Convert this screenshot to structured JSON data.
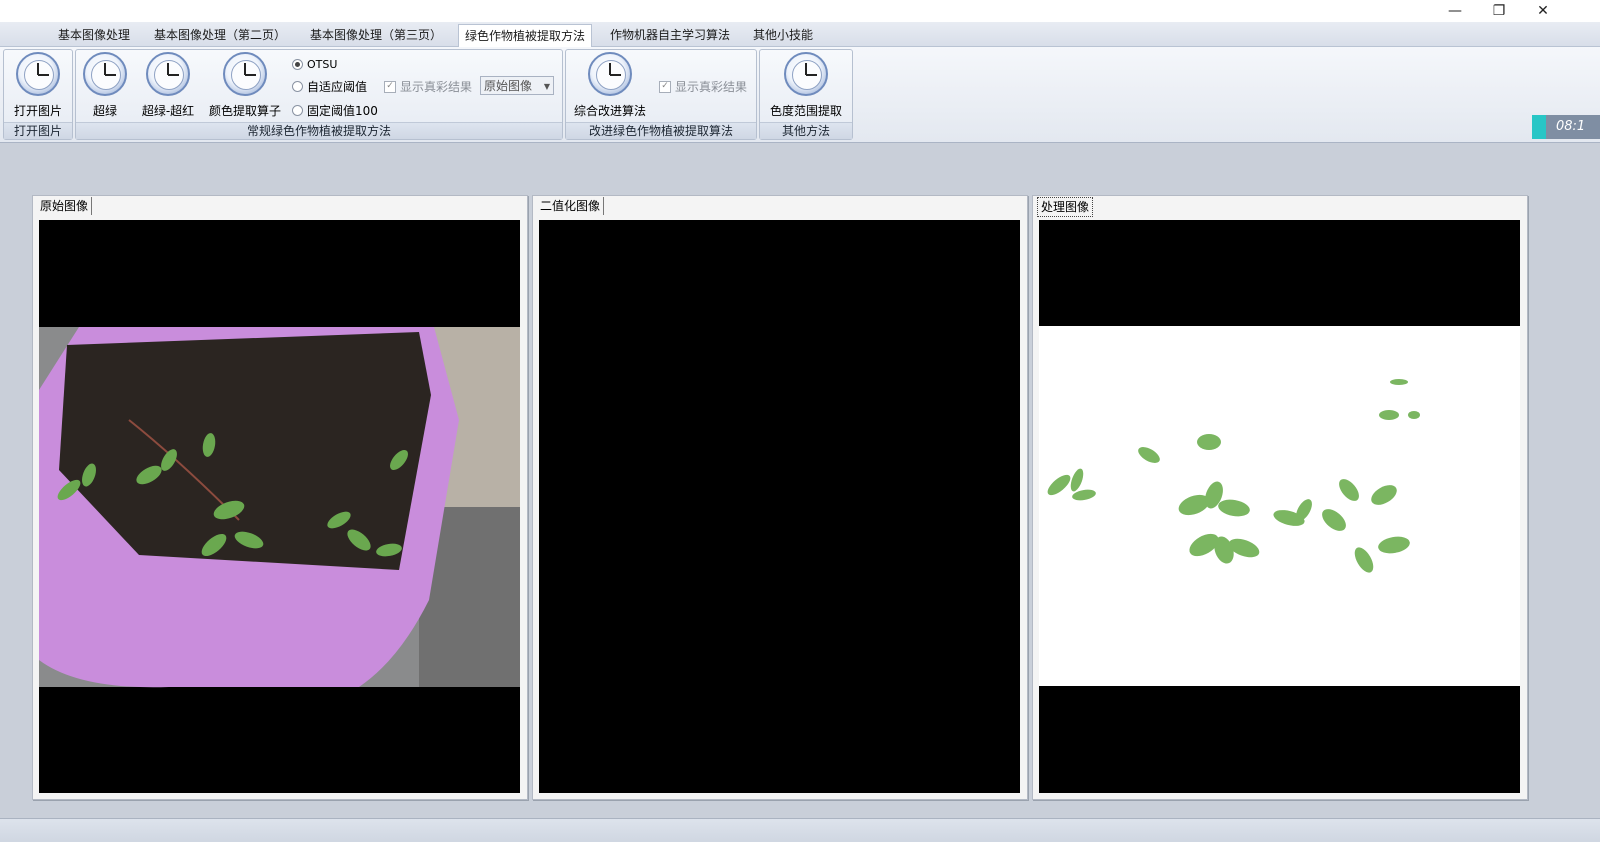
{
  "tabs": [
    {
      "label": "基本图像处理"
    },
    {
      "label": "基本图像处理（第二页）"
    },
    {
      "label": "基本图像处理（第三页）"
    },
    {
      "label": "绿色作物植被提取方法"
    },
    {
      "label": "作物机器自主学习算法"
    },
    {
      "label": "其他小技能"
    }
  ],
  "ribbon": {
    "open_group": {
      "button": "打开图片",
      "caption": "打开图片"
    },
    "conventional_group": {
      "caption": "常规绿色作物植被提取方法",
      "buttons": [
        "超绿",
        "超绿-超红",
        "颜色提取算子"
      ],
      "radios": [
        "OTSU",
        "自适应阈值",
        "固定阈值100"
      ],
      "show_color": "显示真彩结果",
      "combo_value": "原始图像"
    },
    "improved_group": {
      "caption": "改进绿色作物植被提取算法",
      "button": "综合改进算法",
      "show_color": "显示真彩结果"
    },
    "other_group": {
      "caption": "其他方法",
      "button": "色度范围提取"
    }
  },
  "time": "08:1",
  "panels": [
    {
      "tab": "原始图像"
    },
    {
      "tab": "二值化图像"
    },
    {
      "tab": "处理图像"
    }
  ],
  "window_controls": {
    "minimize": "—",
    "restore": "❐",
    "close": "✕"
  }
}
